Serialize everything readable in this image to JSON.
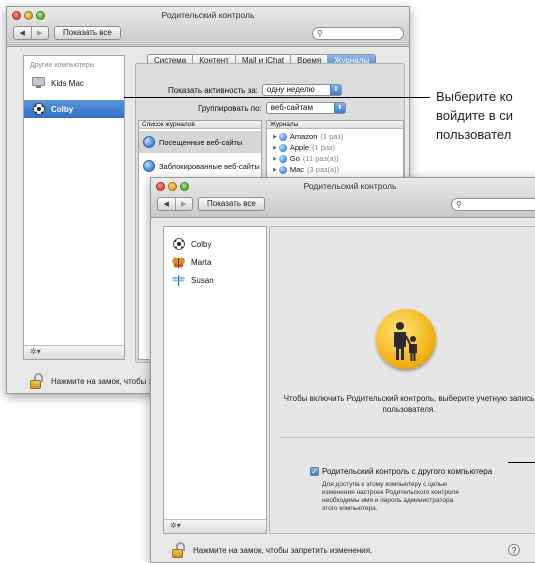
{
  "back_window": {
    "title": "Родительский контроль",
    "show_all": "Показать все",
    "sidebar_header": "Другие компьютеры",
    "users": [
      "Kids Mac",
      "Colby"
    ],
    "tabs": [
      "Система",
      "Контент",
      "Mail и iChat",
      "Время",
      "Журналы"
    ],
    "active_tab": "Журналы",
    "show_activity_label": "Показать активность за:",
    "show_activity_value": "одну неделю",
    "group_by_label": "Группировать по:",
    "group_by_value": "веб-сайтам",
    "logs_header": "Список журналов",
    "logs": [
      "Посещенные веб-сайты",
      "Заблокированные веб-сайты"
    ],
    "journals_header": "Журналы",
    "sites": [
      {
        "name": "Amazon",
        "count": "(1 раз)"
      },
      {
        "name": "Apple",
        "count": "(1 раз)"
      },
      {
        "name": "Go",
        "count": "(11 раз(а))"
      },
      {
        "name": "Mac",
        "count": "(3 раз(а))"
      }
    ],
    "lock_text": "Нажмите на замок, чтобы запр"
  },
  "annotation": {
    "line1": "Выберите ко",
    "line2": "войдите в си",
    "line3": "пользовател"
  },
  "front_window": {
    "title": "Родительский контроль",
    "show_all": "Показать все",
    "users": [
      "Colby",
      "Marta",
      "Susan"
    ],
    "hint": "Чтобы включить Родительский контроль, выберите учетную запись пользователя.",
    "remote_label": "Родительский контроль с другого компьютера",
    "remote_checked": true,
    "remote_desc": "Для доступа к этому компьютеру с целью изменения настроек Родительского контроля необходимы имя и пароль администратора этого компьютера.",
    "lock_text": "Нажмите на замок, чтобы запретить изменения.",
    "help": "?"
  },
  "icons": [
    "close-icon",
    "minimize-icon",
    "maximize-icon",
    "back-arrow-icon",
    "forward-arrow-icon",
    "search-icon",
    "gear-icon",
    "lock-icon",
    "parental-controls-icon",
    "globe-icon",
    "help-icon"
  ],
  "colors": {
    "selection": "#2e6ec5",
    "lock_gold": "#e0aa2c",
    "parental_icon": "#f3b51a"
  }
}
